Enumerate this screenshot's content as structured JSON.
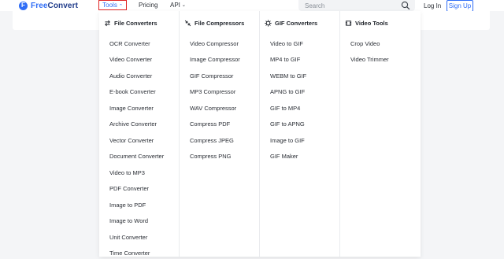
{
  "brand": {
    "name_part1": "Free",
    "name_part2": "Convert"
  },
  "nav": {
    "tools_label": "Tools",
    "pricing_label": "Pricing",
    "api_label": "API"
  },
  "search": {
    "placeholder": "Search"
  },
  "auth": {
    "login_label": "Log In",
    "signup_label": "Sign Up"
  },
  "colors": {
    "accent": "#2f6df6",
    "highlight_border": "#e02424"
  },
  "menu": {
    "columns": [
      {
        "icon": "swap-arrows-icon",
        "title": "File Converters",
        "items": [
          "OCR Converter",
          "Video Converter",
          "Audio Converter",
          "E-book Converter",
          "Image Converter",
          "Archive Converter",
          "Vector Converter",
          "Document Converter",
          "Video to MP3",
          "PDF Converter",
          "Image to PDF",
          "Image to Word",
          "Unit Converter",
          "Time Converter"
        ]
      },
      {
        "icon": "compress-arrows-icon",
        "title": "File Compressors",
        "items": [
          "Video Compressor",
          "Image Compressor",
          "GIF Compressor",
          "MP3 Compressor",
          "WAV Compressor",
          "Compress PDF",
          "Compress JPEG",
          "Compress PNG"
        ]
      },
      {
        "icon": "gif-gear-icon",
        "title": "GIF Converters",
        "items": [
          "Video to GIF",
          "MP4 to GIF",
          "WEBM to GIF",
          "APNG to GIF",
          "GIF to MP4",
          "GIF to APNG",
          "Image to GIF",
          "GIF Maker"
        ]
      },
      {
        "icon": "film-icon",
        "title": "Video Tools",
        "items": [
          "Crop Video",
          "Video Trimmer"
        ]
      }
    ]
  }
}
